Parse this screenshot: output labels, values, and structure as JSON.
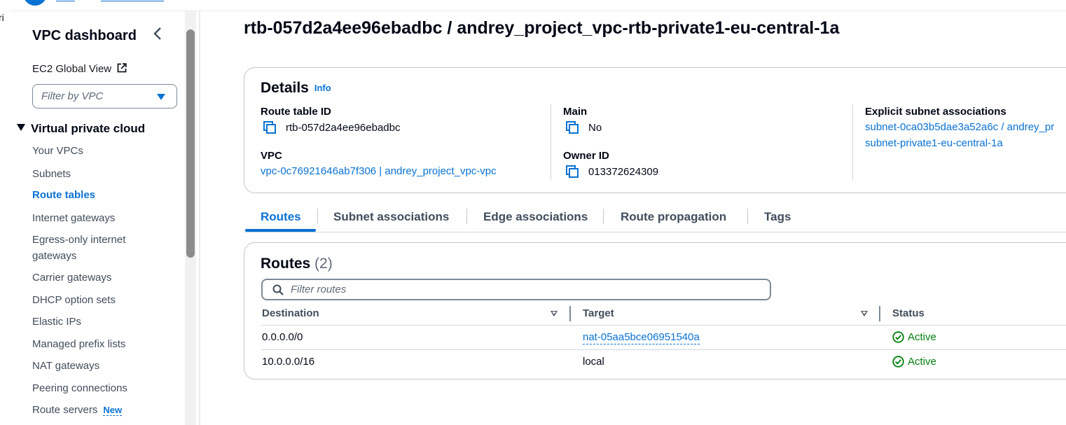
{
  "left_strip_fragment": "ri",
  "sidebar": {
    "title": "VPC dashboard",
    "ec2_global_view": "EC2 Global View",
    "filter_placeholder": "Filter by VPC",
    "section_title": "Virtual private cloud",
    "items": [
      {
        "label": "Your VPCs",
        "active": false
      },
      {
        "label": "Subnets",
        "active": false
      },
      {
        "label": "Route tables",
        "active": true
      },
      {
        "label": "Internet gateways",
        "active": false
      },
      {
        "label": "Egress-only internet gateways",
        "active": false
      },
      {
        "label": "Carrier gateways",
        "active": false
      },
      {
        "label": "DHCP option sets",
        "active": false
      },
      {
        "label": "Elastic IPs",
        "active": false
      },
      {
        "label": "Managed prefix lists",
        "active": false
      },
      {
        "label": "NAT gateways",
        "active": false
      },
      {
        "label": "Peering connections",
        "active": false
      },
      {
        "label": "Route servers",
        "active": false,
        "badge": "New"
      }
    ]
  },
  "page": {
    "title": "rtb-057d2a4ee96ebadbc / andrey_project_vpc-rtb-private1-eu-central-1a"
  },
  "details": {
    "heading": "Details",
    "info": "Info",
    "route_table_id_label": "Route table ID",
    "route_table_id": "rtb-057d2a4ee96ebadbc",
    "main_label": "Main",
    "main_value": "No",
    "explicit_label": "Explicit subnet associations",
    "explicit_value_line1": "subnet-0ca03b5dae3a52a6c / andrey_pr",
    "explicit_value_line2": "subnet-private1-eu-central-1a",
    "vpc_label": "VPC",
    "vpc_value": "vpc-0c76921646ab7f306 | andrey_project_vpc-vpc",
    "owner_label": "Owner ID",
    "owner_value": "013372624309"
  },
  "tabs": [
    "Routes",
    "Subnet associations",
    "Edge associations",
    "Route propagation",
    "Tags"
  ],
  "routes": {
    "heading": "Routes",
    "count": "(2)",
    "filter_placeholder": "Filter routes",
    "columns": [
      "Destination",
      "Target",
      "Status"
    ],
    "rows": [
      {
        "destination": "0.0.0.0/0",
        "target": "nat-05aa5bce06951540a",
        "target_is_link": true,
        "status": "Active"
      },
      {
        "destination": "10.0.0.0/16",
        "target": "local",
        "target_is_link": false,
        "status": "Active"
      }
    ]
  },
  "colors": {
    "link": "#0972d3",
    "success": "#037f0c",
    "text": "#000716"
  }
}
